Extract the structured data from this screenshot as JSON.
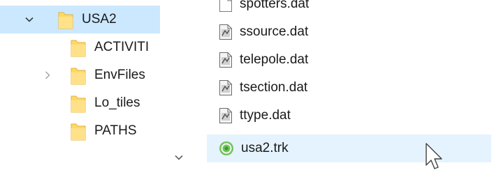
{
  "navigation_tree": {
    "items": [
      {
        "label": "USA2",
        "expanded": true,
        "selected": true
      },
      {
        "label": "ACTIVITI"
      },
      {
        "label": "EnvFiles",
        "expandable": true
      },
      {
        "label": "Lo_tiles"
      },
      {
        "label": "PATHS"
      }
    ]
  },
  "file_list": {
    "items": [
      {
        "name": "spotters.dat",
        "icon": "generic-file-icon"
      },
      {
        "name": "ssource.dat",
        "icon": "dat-file-icon"
      },
      {
        "name": "telepole.dat",
        "icon": "dat-file-icon"
      },
      {
        "name": "tsection.dat",
        "icon": "dat-file-icon"
      },
      {
        "name": "ttype.dat",
        "icon": "dat-file-icon"
      },
      {
        "name": "usa2.trk",
        "icon": "trk-file-icon",
        "hover": true
      }
    ]
  },
  "colors": {
    "selection": "#cce8ff",
    "hover": "#e5f3ff",
    "folder": "#ffd865",
    "text": "#1a1a1a"
  }
}
